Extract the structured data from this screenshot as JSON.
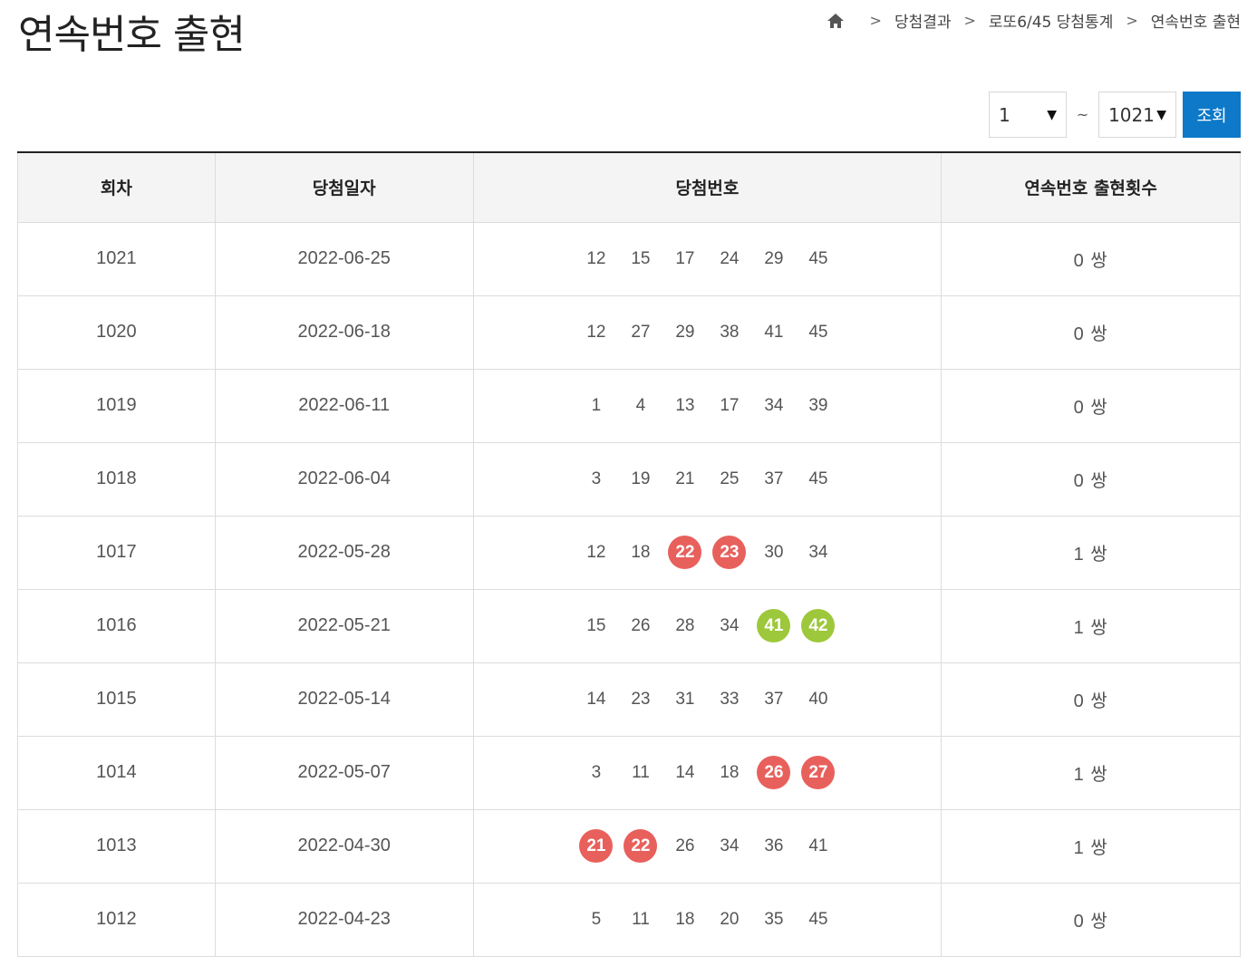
{
  "page": {
    "title": "연속번호 출현"
  },
  "breadcrumb": {
    "home_icon": "home-icon",
    "items": [
      "당첨결과",
      "로또6/45 당첨통계",
      "연속번호 출현"
    ]
  },
  "filter": {
    "from_value": "1",
    "to_value": "1021",
    "tilde": "~",
    "search_label": "조회"
  },
  "colors": {
    "accent": "#0e79c9",
    "red_ball": "#e8605c",
    "green_ball": "#9ec83b"
  },
  "table": {
    "headers": [
      "회차",
      "당첨일자",
      "당첨번호",
      "연속번호 출현횟수"
    ],
    "rows": [
      {
        "round": "1021",
        "date": "2022-06-25",
        "numbers": [
          "12",
          "15",
          "17",
          "24",
          "29",
          "45"
        ],
        "highlight": [],
        "hl_color": "",
        "count": "0 쌍"
      },
      {
        "round": "1020",
        "date": "2022-06-18",
        "numbers": [
          "12",
          "27",
          "29",
          "38",
          "41",
          "45"
        ],
        "highlight": [],
        "hl_color": "",
        "count": "0 쌍"
      },
      {
        "round": "1019",
        "date": "2022-06-11",
        "numbers": [
          "1",
          "4",
          "13",
          "17",
          "34",
          "39"
        ],
        "highlight": [],
        "hl_color": "",
        "count": "0 쌍"
      },
      {
        "round": "1018",
        "date": "2022-06-04",
        "numbers": [
          "3",
          "19",
          "21",
          "25",
          "37",
          "45"
        ],
        "highlight": [],
        "hl_color": "",
        "count": "0 쌍"
      },
      {
        "round": "1017",
        "date": "2022-05-28",
        "numbers": [
          "12",
          "18",
          "22",
          "23",
          "30",
          "34"
        ],
        "highlight": [
          2,
          3
        ],
        "hl_color": "red",
        "count": "1 쌍"
      },
      {
        "round": "1016",
        "date": "2022-05-21",
        "numbers": [
          "15",
          "26",
          "28",
          "34",
          "41",
          "42"
        ],
        "highlight": [
          4,
          5
        ],
        "hl_color": "green",
        "count": "1 쌍"
      },
      {
        "round": "1015",
        "date": "2022-05-14",
        "numbers": [
          "14",
          "23",
          "31",
          "33",
          "37",
          "40"
        ],
        "highlight": [],
        "hl_color": "",
        "count": "0 쌍"
      },
      {
        "round": "1014",
        "date": "2022-05-07",
        "numbers": [
          "3",
          "11",
          "14",
          "18",
          "26",
          "27"
        ],
        "highlight": [
          4,
          5
        ],
        "hl_color": "red",
        "count": "1 쌍"
      },
      {
        "round": "1013",
        "date": "2022-04-30",
        "numbers": [
          "21",
          "22",
          "26",
          "34",
          "36",
          "41"
        ],
        "highlight": [
          0,
          1
        ],
        "hl_color": "red",
        "count": "1 쌍"
      },
      {
        "round": "1012",
        "date": "2022-04-23",
        "numbers": [
          "5",
          "11",
          "18",
          "20",
          "35",
          "45"
        ],
        "highlight": [],
        "hl_color": "",
        "count": "0 쌍"
      }
    ]
  }
}
